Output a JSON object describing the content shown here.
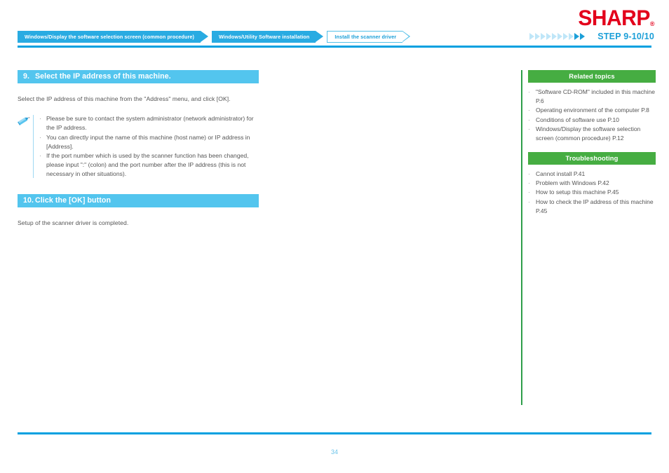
{
  "header": {
    "logo_text": "SHARP",
    "logo_registered": "®",
    "logo_color": "#e3001b",
    "breadcrumbs": [
      {
        "label": "Windows/Display the software selection screen (common procedure)",
        "state": "filled"
      },
      {
        "label": "Windows/Utility Software installation",
        "state": "filled"
      },
      {
        "label": "Install the scanner driver",
        "state": "outline"
      }
    ],
    "step_label": "STEP  9-10/10",
    "progress": {
      "total": 10,
      "completed": 2,
      "open": 8,
      "open_color": "#bfe6f8",
      "done_color": "#1b9fd8"
    },
    "accent_color": "#00a0e0"
  },
  "main": {
    "steps": [
      {
        "number": "9.",
        "title": "Select the IP address of this machine.",
        "body": "Select the IP address of this machine from the \"Address\" menu, and click [OK]."
      },
      {
        "number": "10.",
        "title": "Click the [OK] button",
        "body": "Setup of the scanner driver is completed."
      }
    ],
    "note": {
      "icon": "pencil-note-icon",
      "bullet": "·",
      "items": [
        "Please be sure to contact the system administrator  (network administrator) for the IP address.",
        "You can directly input the name of this machine (host name) or IP address in [Address].",
        "If the port number which is used by the scanner function has been changed, please input \":\" (colon) and the port number after the IP address (this is not necessary in other situations)."
      ]
    },
    "step_bar_color": "#53c5ee"
  },
  "sidebar": {
    "accent_color": "#46ad42",
    "rule_color": "#2e9e4a",
    "bullet": "·",
    "panels": [
      {
        "title": "Related topics",
        "items": [
          "\"Software CD-ROM\" included in this machine P.6",
          "Operating environment of the computer P.8",
          "Conditions of software use P.10",
          "Windows/Display the software selection screen (common procedure) P.12"
        ]
      },
      {
        "title": "Troubleshooting",
        "items": [
          "Cannot install P.41",
          "Problem with Windows P.42",
          "How to setup this machine P.45",
          "How to check the IP address of this machine P.45"
        ]
      }
    ]
  },
  "footer": {
    "page_number": "34",
    "rule_color": "#00a0e0"
  }
}
